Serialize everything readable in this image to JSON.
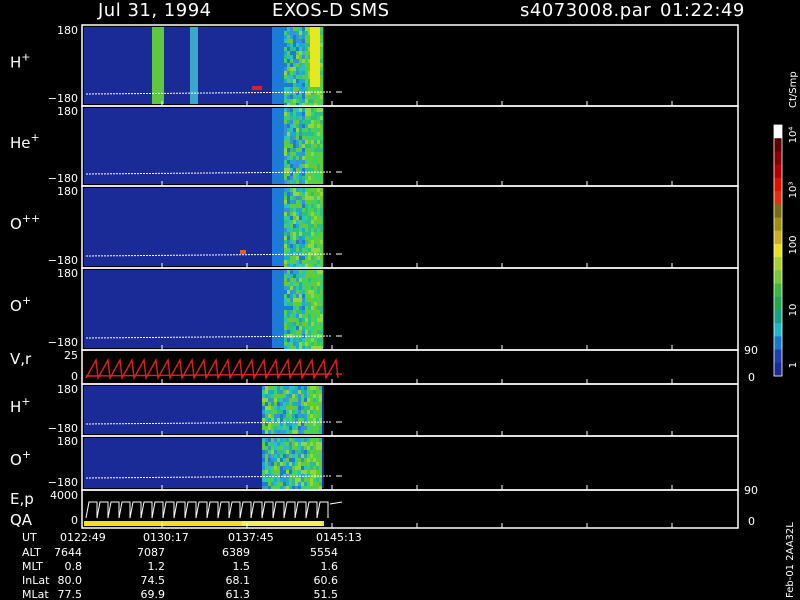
{
  "header": {
    "date": "Jul 31, 1994",
    "instrument": "EXOS-D SMS",
    "file": "s4073008.par",
    "time": "01:22:49"
  },
  "colorbar": {
    "unit": "Ct/Smp",
    "ticks": [
      "1",
      "10",
      "100",
      "10³",
      "10⁴"
    ]
  },
  "side_label": "Feb-01 2AA32L",
  "footer": {
    "row_labels": [
      "UT",
      "ALT",
      "MLT",
      "InLat",
      "MLat"
    ],
    "columns": [
      [
        "0122:49",
        "0130:17",
        "0137:45",
        "0145:13"
      ],
      [
        "7644",
        "7087",
        "6389",
        "5554"
      ],
      [
        "0.8",
        "1.2",
        "1.5",
        "1.6"
      ],
      [
        "80.0",
        "74.5",
        "68.1",
        "60.6"
      ],
      [
        "77.5",
        "69.9",
        "61.3",
        "51.5"
      ]
    ]
  },
  "colors": {
    "background": "#000000",
    "spectrogram_base": "#1a2a96",
    "trace_red": "#e02020",
    "trace_white": "#ffffff",
    "quality_bar": "#f0e020"
  },
  "chart_data": {
    "type": "heatmap",
    "panels": [
      {
        "label": "H",
        "sup": "+",
        "ytop": "180",
        "ybottom": "−180"
      },
      {
        "label": "He",
        "sup": "+",
        "ytop": "180",
        "ybottom": "−180"
      },
      {
        "label": "O",
        "sup": "++",
        "ytop": "180",
        "ybottom": "−180"
      },
      {
        "label": "O",
        "sup": "+",
        "ytop": "180",
        "ybottom": "−180"
      },
      {
        "label": "V,r",
        "sup": "",
        "ytop": "25",
        "ybottom": "0",
        "right_top": "90",
        "right_bottom": "0"
      },
      {
        "label": "H",
        "sup": "+",
        "ytop": "180",
        "ybottom": "−180"
      },
      {
        "label": "O",
        "sup": "+",
        "ytop": "180",
        "ybottom": "−180"
      },
      {
        "label": "E,p",
        "label2": "QA",
        "sup": "",
        "ytop": "4000",
        "ybottom": "0",
        "right_top": "90",
        "right_bottom": "0"
      }
    ],
    "x_ticks": [
      "0122:49",
      "0130:17",
      "0137:45",
      "0145:13"
    ],
    "colorbar_scale": "log",
    "colorbar_range": [
      1,
      10000
    ]
  }
}
